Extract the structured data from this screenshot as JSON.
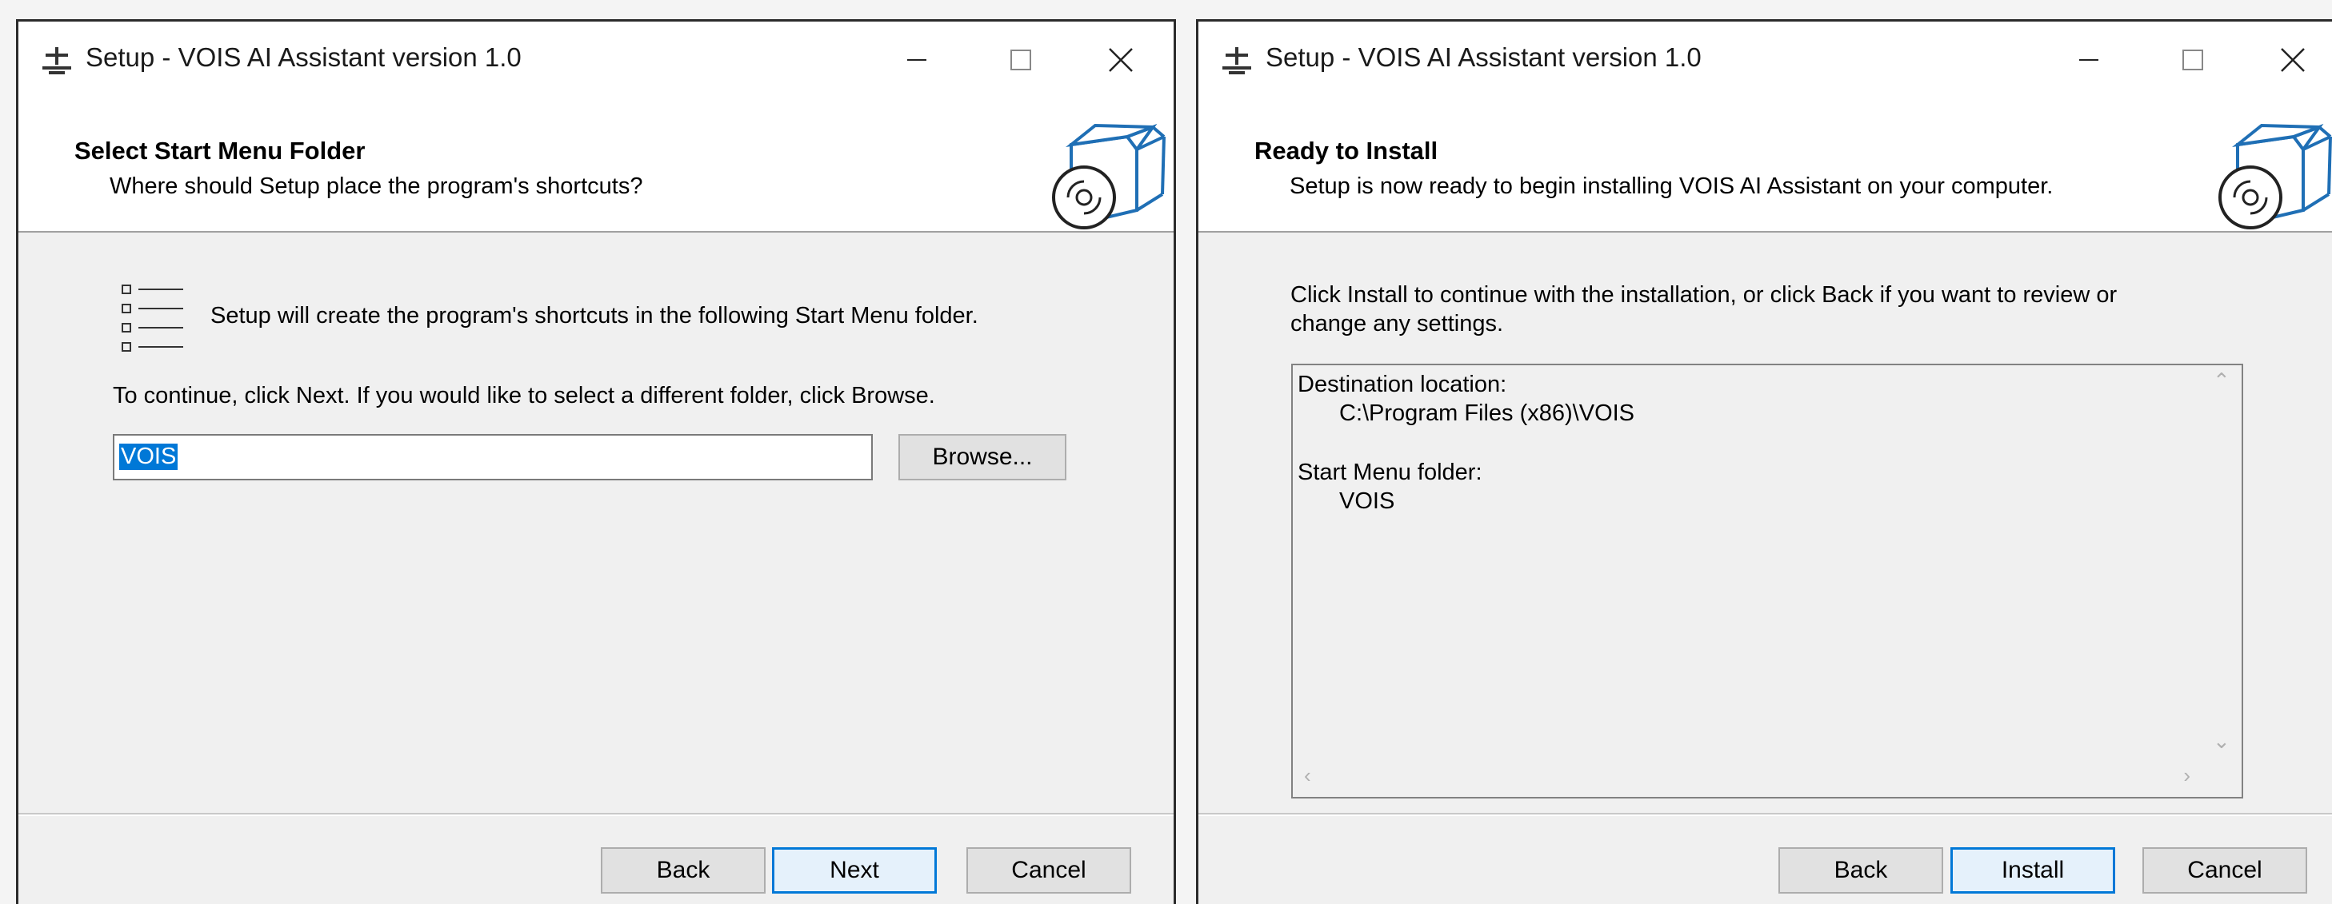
{
  "left_window": {
    "title": "Setup - VOIS AI Assistant version 1.0",
    "header_title": "Select Start Menu Folder",
    "header_subtitle": "Where should Setup place the program's shortcuts?",
    "info_text": "Setup will create the program's shortcuts in the following Start Menu folder.",
    "continue_text": "To continue, click Next. If you would like to select a different folder, click Browse.",
    "folder_value": "VOIS",
    "browse_label": "Browse...",
    "back_label": "Back",
    "next_label": "Next",
    "cancel_label": "Cancel"
  },
  "right_window": {
    "title": "Setup - VOIS AI Assistant version 1.0",
    "header_title": "Ready to Install",
    "header_subtitle": "Setup is now ready to begin installing VOIS AI Assistant on your computer.",
    "instruction_line1": "Click Install to continue with the installation, or click Back if you want to review or",
    "instruction_line2": "change any settings.",
    "memo": {
      "dest_label": "Destination location:",
      "dest_value": "C:\\Program Files (x86)\\VOIS",
      "menu_label": "Start Menu folder:",
      "menu_value": "VOIS"
    },
    "back_label": "Back",
    "install_label": "Install",
    "cancel_label": "Cancel"
  },
  "icons": [
    "setup-app-icon",
    "minimize-icon",
    "maximize-icon",
    "close-icon",
    "install-box-icon",
    "list-icon",
    "scroll-up-icon",
    "scroll-down-icon",
    "scroll-left-icon",
    "scroll-right-icon"
  ],
  "colors": {
    "accent": "#0078d7",
    "window_bg": "#f0f0f0",
    "header_bg": "#ffffff",
    "box_blue": "#1f6fb5"
  }
}
